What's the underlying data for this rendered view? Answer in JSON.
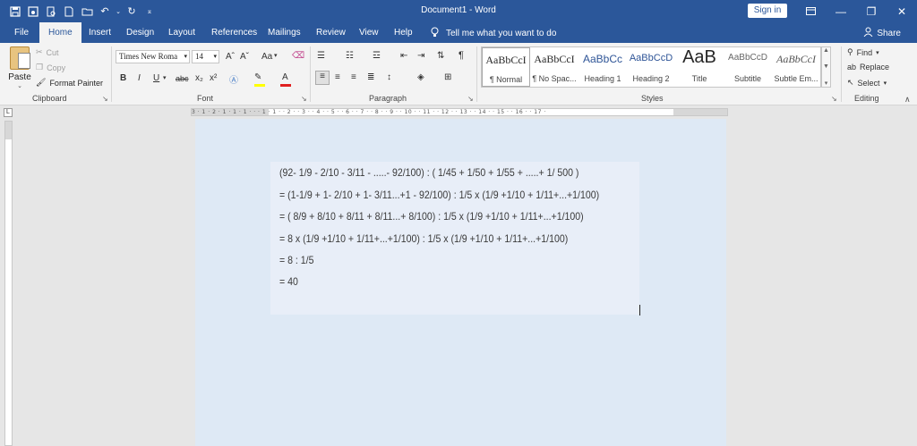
{
  "titlebar": {
    "doc_title": "Document1  -  Word",
    "signin": "Sign in",
    "qat_icons": [
      "save-icon",
      "autosave-icon",
      "print-preview-icon",
      "new-document-icon",
      "open-folder-icon",
      "undo-icon",
      "redo-icon",
      "customize-qat-icon"
    ]
  },
  "tabs": [
    "File",
    "Home",
    "Insert",
    "Design",
    "Layout",
    "References",
    "Mailings",
    "Review",
    "View",
    "Help"
  ],
  "tellme": "Tell me what you want to do",
  "share": "Share",
  "clipboard": {
    "paste": "Paste",
    "cut": "Cut",
    "copy": "Copy",
    "format_painter": "Format Painter",
    "label": "Clipboard"
  },
  "font": {
    "name": "Times New Roma",
    "size": "14",
    "grow": "Aˆ",
    "shrink": "Aˇ",
    "change_case": "Aa",
    "bold": "B",
    "italic": "I",
    "underline": "U",
    "strike": "abc",
    "subscript": "x₂",
    "superscript": "x²",
    "label": "Font",
    "highlight_color": "#ffff00",
    "font_color": "#e02020"
  },
  "paragraph": {
    "label": "Paragraph",
    "pilcrow": "¶"
  },
  "styles": {
    "label": "Styles",
    "items": [
      {
        "sample": "AaBbCcI",
        "name": "¶ Normal"
      },
      {
        "sample": "AaBbCcI",
        "name": "¶ No Spac..."
      },
      {
        "sample": "AaBbCc",
        "name": "Heading 1"
      },
      {
        "sample": "AaBbCcD",
        "name": "Heading 2"
      },
      {
        "sample": "AaB",
        "name": "Title"
      },
      {
        "sample": "AaBbCcD",
        "name": "Subtitle"
      },
      {
        "sample": "AaBbCcI",
        "name": "Subtle Em..."
      }
    ]
  },
  "editing": {
    "find": "Find",
    "replace": "Replace",
    "select": "Select",
    "label": "Editing"
  },
  "ruler": {
    "marks": "3 · 1 · 2 · 1 · 1 · 1 · · · 1 · 1 · · 2 · · 3 · · 4 · · 5 · · 6 · · 7 · · 8 · · 9 · · 10 · · 11 · · 12 · · 13 · · 14 · · 15 · · 16 · · 17 ·"
  },
  "document": {
    "lines": [
      "(92- 1/9 - 2/10 - 3/11 - .....- 92/100) : ( 1/45 + 1/50 + 1/55 + .....+ 1/ 500 )",
      "= (1-1/9 + 1- 2/10 + 1- 3/11...+1 - 92/100) : 1/5 x (1/9 +1/10 + 1/11+...+1/100)",
      "= ( 8/9 + 8/10 + 8/11 + 8/11...+ 8/100) : 1/5 x (1/9 +1/10 + 1/11+...+1/100)",
      "= 8 x (1/9 +1/10 + 1/11+...+1/100) : 1/5 x (1/9 +1/10 + 1/11+...+1/100)",
      "= 8 : 1/5",
      "= 40"
    ]
  }
}
